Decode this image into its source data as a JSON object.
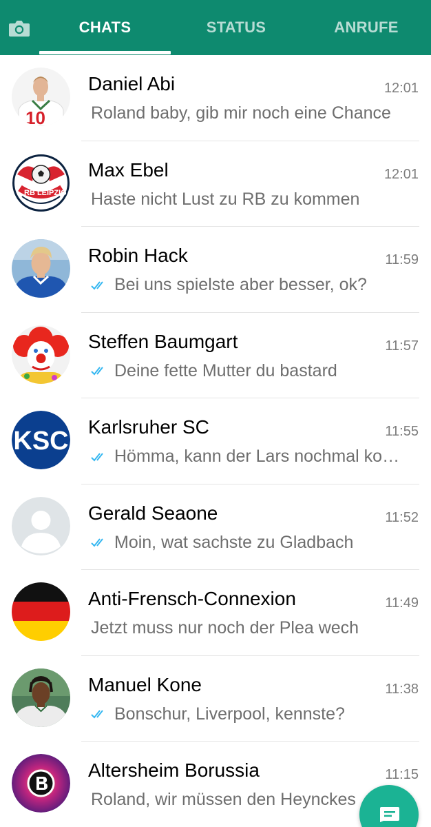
{
  "tabs": {
    "camera_icon": "camera-icon",
    "chats": "CHATS",
    "status": "STATUS",
    "calls": "ANRUFE",
    "active": "chats"
  },
  "colors": {
    "header": "#0e8a6f",
    "fab": "#1bb394",
    "read_ticks": "#34b7f1"
  },
  "chats": [
    {
      "name": "Daniel Abi",
      "time": "12:01",
      "preview": "Roland baby, gib mir noch eine Chance",
      "ticks": false
    },
    {
      "name": "Max Ebel",
      "time": "12:01",
      "preview": "Haste nicht Lust zu RB zu kommen",
      "ticks": false
    },
    {
      "name": "Robin Hack",
      "time": "11:59",
      "preview": "Bei uns spielste aber besser, ok?",
      "ticks": true
    },
    {
      "name": "Steffen Baumgart",
      "time": "11:57",
      "preview": "Deine fette Mutter du bastard",
      "ticks": true
    },
    {
      "name": "Karlsruher SC",
      "time": "11:55",
      "preview": "Hömma, kann der Lars nochmal ko…",
      "ticks": true,
      "avatar_text": "KSC"
    },
    {
      "name": "Gerald Seaone",
      "time": "11:52",
      "preview": "Moin, wat sachste zu Gladbach",
      "ticks": true
    },
    {
      "name": "Anti-Frensch-Connexion",
      "time": "11:49",
      "preview": "Jetzt muss nur noch der Plea wech",
      "ticks": false
    },
    {
      "name": "Manuel Kone",
      "time": "11:38",
      "preview": "Bonschur, Liverpool, kennste?",
      "ticks": true
    },
    {
      "name": "Altersheim Borussia",
      "time": "11:15",
      "preview": "Roland, wir müssen den Heynckes",
      "ticks": false
    }
  ],
  "fab": {
    "icon": "new-chat-icon"
  }
}
